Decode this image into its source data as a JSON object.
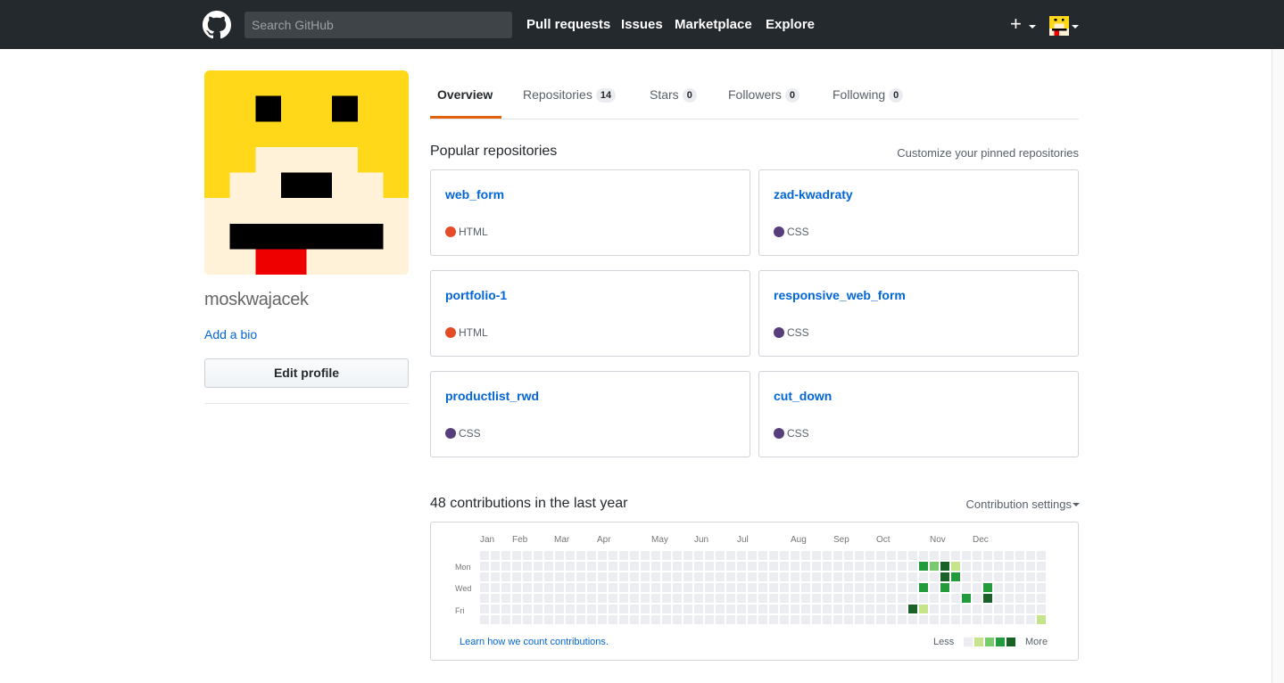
{
  "header": {
    "search_placeholder": "Search GitHub",
    "nav": [
      "Pull requests",
      "Issues",
      "Marketplace",
      "Explore"
    ],
    "plus": "+"
  },
  "profile": {
    "username": "moskwajacek",
    "add_bio": "Add a bio",
    "edit_profile": "Edit profile"
  },
  "tabs": [
    {
      "label": "Overview",
      "count": null,
      "active": true
    },
    {
      "label": "Repositories",
      "count": "14"
    },
    {
      "label": "Stars",
      "count": "0"
    },
    {
      "label": "Followers",
      "count": "0"
    },
    {
      "label": "Following",
      "count": "0"
    }
  ],
  "popular": {
    "title": "Popular repositories",
    "customize": "Customize your pinned repositories",
    "repos": [
      {
        "name": "web_form",
        "language": "HTML",
        "color": "#e34c26"
      },
      {
        "name": "zad-kwadraty",
        "language": "CSS",
        "color": "#563d7c"
      },
      {
        "name": "portfolio-1",
        "language": "HTML",
        "color": "#e34c26"
      },
      {
        "name": "responsive_web_form",
        "language": "CSS",
        "color": "#563d7c"
      },
      {
        "name": "productlist_rwd",
        "language": "CSS",
        "color": "#563d7c"
      },
      {
        "name": "cut_down",
        "language": "CSS",
        "color": "#563d7c"
      }
    ]
  },
  "contributions": {
    "title": "48 contributions in the last year",
    "settings": "Contribution settings",
    "months": [
      "Jan",
      "Feb",
      "Mar",
      "Apr",
      "May",
      "Jun",
      "Jul",
      "Aug",
      "Sep",
      "Oct",
      "Nov",
      "Dec"
    ],
    "weekdays": [
      "Mon",
      "Wed",
      "Fri"
    ],
    "learn": "Learn how we count contributions.",
    "less": "Less",
    "more": "More",
    "colors": [
      "#ebedf0",
      "#c6e48b",
      "#7bc96f",
      "#239a3b",
      "#196127"
    ],
    "levels": [
      {
        "week": 41,
        "day": 5,
        "level": 1
      },
      {
        "week": 40,
        "day": 5,
        "level": 4
      },
      {
        "week": 41,
        "day": 1,
        "level": 3
      },
      {
        "week": 41,
        "day": 3,
        "level": 3
      },
      {
        "week": 41,
        "day": 7,
        "level": 3
      },
      {
        "week": 42,
        "day": 1,
        "level": 2
      },
      {
        "week": 42,
        "day": 7,
        "level": 2
      },
      {
        "week": 43,
        "day": 1,
        "level": 4
      },
      {
        "week": 43,
        "day": 2,
        "level": 4
      },
      {
        "week": 43,
        "day": 3,
        "level": 3
      },
      {
        "week": 43,
        "day": 7,
        "level": 2
      },
      {
        "week": 44,
        "day": 1,
        "level": 1
      },
      {
        "week": 44,
        "day": 2,
        "level": 3
      },
      {
        "week": 45,
        "day": 4,
        "level": 3
      },
      {
        "week": 47,
        "day": 3,
        "level": 3
      },
      {
        "week": 47,
        "day": 4,
        "level": 4
      },
      {
        "week": 52,
        "day": 6,
        "level": 1
      }
    ]
  }
}
